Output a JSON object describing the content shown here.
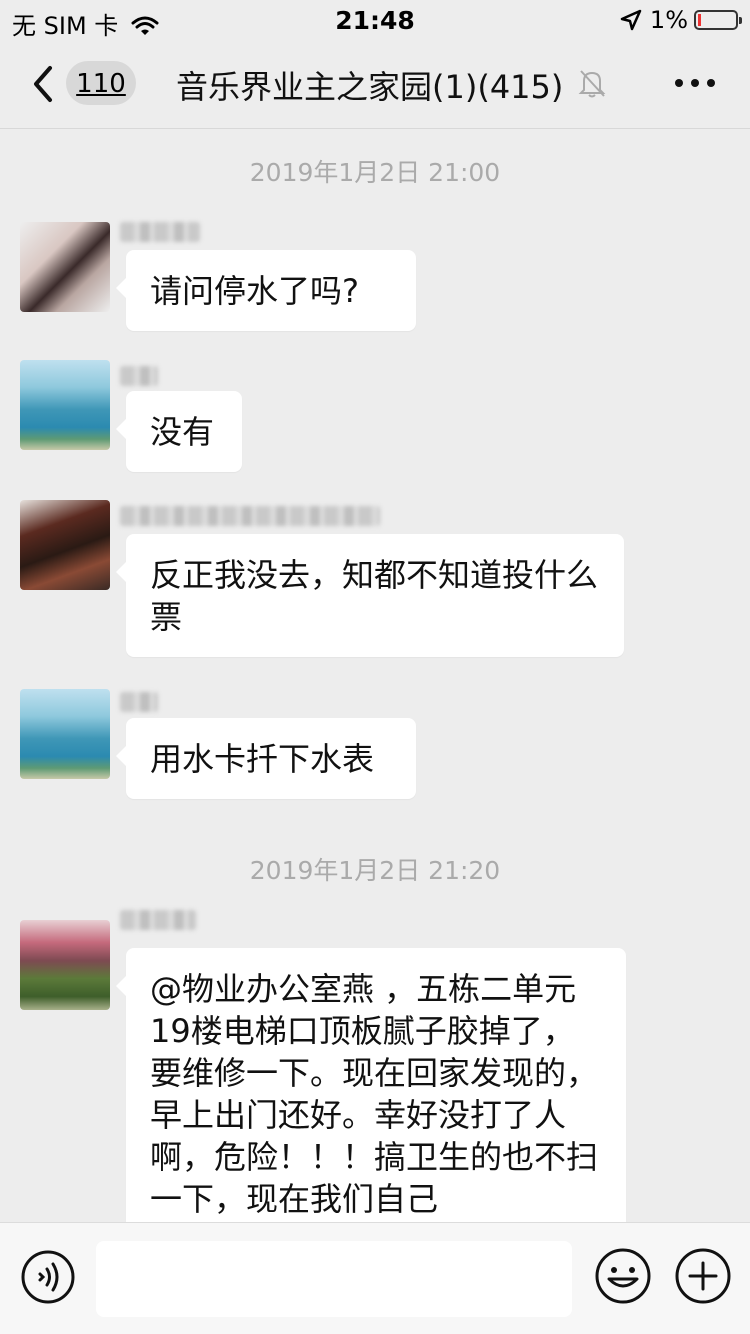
{
  "status_bar": {
    "carrier": "无 SIM 卡",
    "time": "21:48",
    "battery_percent": "1%",
    "battery_level": 0.01
  },
  "nav": {
    "back_count": "110",
    "title": "音乐界业主之家园(1)(415)"
  },
  "messages": [
    {
      "type": "timestamp",
      "text": "2019年1月2日 21:00"
    },
    {
      "type": "message",
      "text": "请问停水了吗?"
    },
    {
      "type": "message",
      "text": "没有"
    },
    {
      "type": "message",
      "text": "反正我没去，知都不知道投什么票"
    },
    {
      "type": "message",
      "text": "用水卡扦下水表"
    },
    {
      "type": "timestamp",
      "text": "2019年1月2日 21:20"
    },
    {
      "type": "message",
      "text": "@物业办公室燕 ，五栋二单元19楼电梯口顶板腻子胶掉了，要维修一下。现在回家发现的，早上出门还好。幸好没打了人啊，危险！！！搞卫生的也不扫一下，现在我们自己"
    }
  ],
  "input": {
    "placeholder": ""
  },
  "colors": {
    "background": "#ededed",
    "bubble": "#ffffff",
    "timestamp_text": "#aaaaaa",
    "battery_low": "#ee3333"
  },
  "icons": [
    "chevron-left-icon",
    "mute-bell-icon",
    "more-icon",
    "voice-icon",
    "emoji-icon",
    "plus-icon",
    "wifi-icon",
    "location-arrow-icon",
    "battery-icon"
  ]
}
